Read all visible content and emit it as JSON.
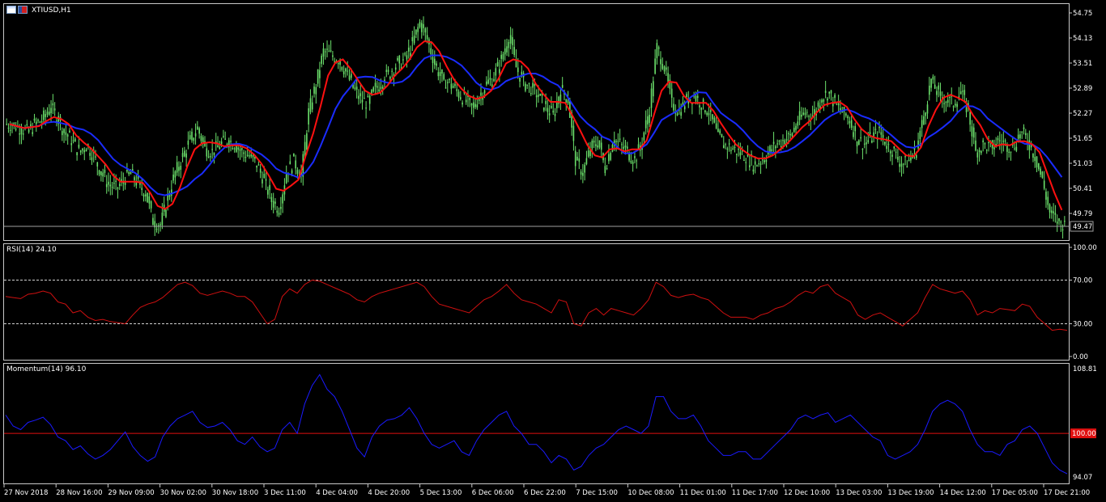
{
  "window": {
    "symbol_title": "XTIUSD,H1",
    "icons": [
      "table-icon",
      "flag-icon"
    ]
  },
  "colors": {
    "background": "#000000",
    "candle": "#6be06b",
    "ma_fast": "#ff1010",
    "ma_slow": "#1a2cff",
    "rsi_line": "#d01010",
    "momentum_line": "#1a1aff",
    "momentum_base": "#e01010",
    "grid_border": "#c8c8c8",
    "price_marker": "#a0a0a0"
  },
  "price_pane": {
    "axis_ticks": [
      "54.75",
      "54.13",
      "53.51",
      "52.89",
      "52.27",
      "51.65",
      "51.03",
      "50.41",
      "49.79"
    ],
    "current_price_label": "49.47",
    "ylim": [
      49.25,
      54.85
    ]
  },
  "rsi_pane": {
    "label": "RSI(14) 24.10",
    "axis_ticks": [
      "100.00",
      "70.00",
      "30.00",
      "0.00"
    ],
    "levels": [
      70,
      30
    ]
  },
  "momentum_pane": {
    "label": "Momentum(14) 96.10",
    "axis_ticks": [
      "108.81",
      "94.07"
    ],
    "base_label": "100.00",
    "ylim": [
      94.07,
      108.81
    ]
  },
  "time_axis": {
    "labels": [
      "27 Nov 2018",
      "28 Nov 16:00",
      "29 Nov 09:00",
      "30 Nov 02:00",
      "30 Nov 18:00",
      "3 Dec 11:00",
      "4 Dec 04:00",
      "4 Dec 20:00",
      "5 Dec 13:00",
      "6 Dec 06:00",
      "6 Dec 22:00",
      "7 Dec 15:00",
      "10 Dec 08:00",
      "11 Dec 01:00",
      "11 Dec 17:00",
      "12 Dec 10:00",
      "13 Dec 03:00",
      "13 Dec 19:00",
      "14 Dec 12:00",
      "17 Dec 05:00",
      "17 Dec 21:00"
    ]
  },
  "chart_data": {
    "type": "candlestick",
    "close_path": [
      52.0,
      51.9,
      51.8,
      52.0,
      52.1,
      52.4,
      52.2,
      51.8,
      51.6,
      51.3,
      51.5,
      51.2,
      50.8,
      50.5,
      50.4,
      50.6,
      50.8,
      50.5,
      50.3,
      49.6,
      49.5,
      50.2,
      50.8,
      51.2,
      51.6,
      51.9,
      51.4,
      51.3,
      51.5,
      51.6,
      51.5,
      51.3,
      51.2,
      51.0,
      50.6,
      50.1,
      49.9,
      50.8,
      51.1,
      50.7,
      52.3,
      53.0,
      53.8,
      53.7,
      53.6,
      53.3,
      52.9,
      52.6,
      52.5,
      52.9,
      53.1,
      53.3,
      53.5,
      53.6,
      54.0,
      54.5,
      54.1,
      53.5,
      53.1,
      53.0,
      52.8,
      52.6,
      52.4,
      52.7,
      53.0,
      53.2,
      53.6,
      54.2,
      53.4,
      53.0,
      52.9,
      52.7,
      52.4,
      52.2,
      52.9,
      52.6,
      51.1,
      50.8,
      51.4,
      51.6,
      50.9,
      51.6,
      51.5,
      51.3,
      51.1,
      51.6,
      52.4,
      53.9,
      53.4,
      52.5,
      52.3,
      52.6,
      52.7,
      52.5,
      52.3,
      51.8,
      51.5,
      51.4,
      51.3,
      51.2,
      51.0,
      51.1,
      51.3,
      51.5,
      51.6,
      51.7,
      52.1,
      52.3,
      52.2,
      52.6,
      52.8,
      52.5,
      52.3,
      52.1,
      51.6,
      51.5,
      51.7,
      51.8,
      51.5,
      51.3,
      51.0,
      51.1,
      51.4,
      52.2,
      53.1,
      52.7,
      52.6,
      52.5,
      52.8,
      52.3,
      51.3,
      51.5,
      51.4,
      51.6,
      51.5,
      51.4,
      51.8,
      51.6,
      51.2,
      50.6,
      49.8,
      49.6,
      49.5
    ],
    "ma_fast_period_note": "",
    "rsi_path": [
      55,
      54,
      53,
      57,
      58,
      60,
      58,
      50,
      48,
      40,
      42,
      36,
      33,
      34,
      32,
      31,
      30,
      38,
      45,
      48,
      50,
      54,
      60,
      66,
      68,
      65,
      58,
      56,
      58,
      60,
      58,
      55,
      55,
      50,
      40,
      30,
      34,
      55,
      62,
      58,
      66,
      70,
      69,
      66,
      63,
      60,
      57,
      52,
      50,
      55,
      58,
      60,
      62,
      64,
      66,
      68,
      64,
      55,
      48,
      46,
      44,
      42,
      40,
      46,
      52,
      55,
      60,
      66,
      58,
      52,
      50,
      48,
      44,
      40,
      52,
      50,
      30,
      28,
      40,
      44,
      38,
      44,
      42,
      40,
      38,
      44,
      52,
      68,
      64,
      56,
      54,
      56,
      57,
      54,
      52,
      46,
      40,
      36,
      36,
      36,
      34,
      38,
      40,
      44,
      46,
      50,
      56,
      60,
      58,
      64,
      66,
      58,
      54,
      50,
      38,
      34,
      38,
      40,
      36,
      32,
      28,
      34,
      40,
      54,
      66,
      62,
      60,
      58,
      60,
      52,
      38,
      42,
      40,
      44,
      43,
      42,
      48,
      46,
      36,
      30,
      24,
      25,
      24
    ],
    "momentum_path": [
      102.5,
      101.0,
      100.5,
      101.5,
      101.8,
      102.2,
      101.2,
      99.5,
      99.0,
      97.8,
      98.3,
      97.2,
      96.5,
      97.0,
      97.8,
      99.0,
      100.2,
      98.2,
      97.0,
      96.2,
      96.8,
      99.5,
      101.0,
      102.0,
      102.5,
      103.0,
      101.5,
      100.8,
      101.0,
      101.5,
      100.5,
      99.0,
      98.5,
      99.5,
      98.2,
      97.5,
      98.0,
      100.5,
      101.5,
      100.0,
      104.0,
      106.5,
      108.0,
      106.0,
      105.0,
      103.0,
      100.5,
      98.0,
      96.8,
      99.5,
      101.0,
      101.8,
      102.0,
      102.5,
      103.5,
      102.0,
      100.0,
      98.5,
      98.0,
      98.5,
      99.0,
      97.5,
      97.0,
      99.0,
      100.5,
      101.5,
      102.5,
      103.0,
      101.0,
      100.0,
      98.5,
      98.5,
      97.5,
      96.0,
      97.0,
      96.5,
      95.0,
      95.5,
      97.0,
      98.0,
      98.5,
      99.5,
      100.5,
      101.0,
      100.5,
      100.0,
      101.0,
      105.0,
      105.0,
      103.0,
      102.0,
      102.0,
      102.5,
      101.0,
      99.0,
      98.0,
      97.0,
      97.0,
      97.5,
      97.5,
      96.5,
      96.5,
      97.5,
      98.5,
      99.5,
      100.5,
      102.0,
      102.5,
      102.0,
      102.5,
      102.8,
      101.5,
      102.0,
      102.5,
      101.5,
      100.5,
      99.5,
      99.0,
      97.0,
      96.5,
      97.0,
      97.5,
      98.5,
      100.5,
      103.0,
      104.0,
      104.5,
      104.0,
      103.0,
      100.5,
      98.5,
      97.5,
      97.5,
      97.0,
      98.5,
      99.0,
      100.5,
      101.0,
      100.0,
      98.0,
      96.0,
      95.0,
      94.5
    ]
  }
}
